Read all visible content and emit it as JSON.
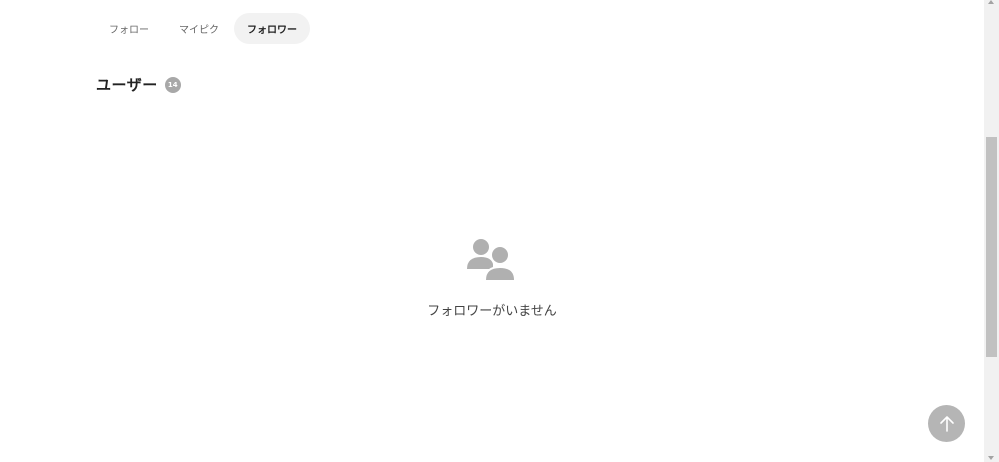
{
  "tabs": [
    {
      "label": "フォロー",
      "active": false
    },
    {
      "label": "マイピク",
      "active": false
    },
    {
      "label": "フォロワー",
      "active": true
    }
  ],
  "section": {
    "title": "ユーザー",
    "count": "14"
  },
  "empty_state": {
    "icon": "users-icon",
    "message": "フォロワーがいません"
  },
  "back_to_top": {
    "icon": "arrow-up-icon"
  },
  "colors": {
    "active_tab_bg": "#f2f2f2",
    "badge_bg": "#a8a8a8",
    "icon_gray": "#b0b0b0",
    "back_to_top_bg": "#b5b5b5"
  }
}
